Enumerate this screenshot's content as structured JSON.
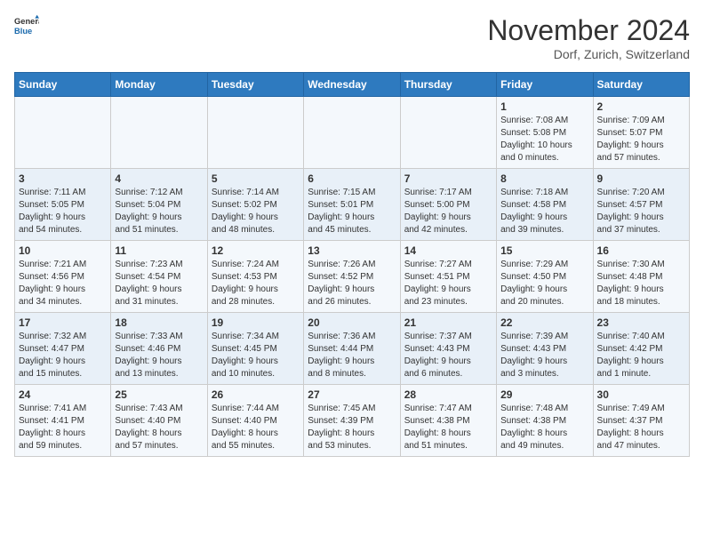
{
  "header": {
    "logo_line1": "General",
    "logo_line2": "Blue",
    "month_title": "November 2024",
    "location": "Dorf, Zurich, Switzerland"
  },
  "weekdays": [
    "Sunday",
    "Monday",
    "Tuesday",
    "Wednesday",
    "Thursday",
    "Friday",
    "Saturday"
  ],
  "weeks": [
    [
      {
        "day": "",
        "info": ""
      },
      {
        "day": "",
        "info": ""
      },
      {
        "day": "",
        "info": ""
      },
      {
        "day": "",
        "info": ""
      },
      {
        "day": "",
        "info": ""
      },
      {
        "day": "1",
        "info": "Sunrise: 7:08 AM\nSunset: 5:08 PM\nDaylight: 10 hours\nand 0 minutes."
      },
      {
        "day": "2",
        "info": "Sunrise: 7:09 AM\nSunset: 5:07 PM\nDaylight: 9 hours\nand 57 minutes."
      }
    ],
    [
      {
        "day": "3",
        "info": "Sunrise: 7:11 AM\nSunset: 5:05 PM\nDaylight: 9 hours\nand 54 minutes."
      },
      {
        "day": "4",
        "info": "Sunrise: 7:12 AM\nSunset: 5:04 PM\nDaylight: 9 hours\nand 51 minutes."
      },
      {
        "day": "5",
        "info": "Sunrise: 7:14 AM\nSunset: 5:02 PM\nDaylight: 9 hours\nand 48 minutes."
      },
      {
        "day": "6",
        "info": "Sunrise: 7:15 AM\nSunset: 5:01 PM\nDaylight: 9 hours\nand 45 minutes."
      },
      {
        "day": "7",
        "info": "Sunrise: 7:17 AM\nSunset: 5:00 PM\nDaylight: 9 hours\nand 42 minutes."
      },
      {
        "day": "8",
        "info": "Sunrise: 7:18 AM\nSunset: 4:58 PM\nDaylight: 9 hours\nand 39 minutes."
      },
      {
        "day": "9",
        "info": "Sunrise: 7:20 AM\nSunset: 4:57 PM\nDaylight: 9 hours\nand 37 minutes."
      }
    ],
    [
      {
        "day": "10",
        "info": "Sunrise: 7:21 AM\nSunset: 4:56 PM\nDaylight: 9 hours\nand 34 minutes."
      },
      {
        "day": "11",
        "info": "Sunrise: 7:23 AM\nSunset: 4:54 PM\nDaylight: 9 hours\nand 31 minutes."
      },
      {
        "day": "12",
        "info": "Sunrise: 7:24 AM\nSunset: 4:53 PM\nDaylight: 9 hours\nand 28 minutes."
      },
      {
        "day": "13",
        "info": "Sunrise: 7:26 AM\nSunset: 4:52 PM\nDaylight: 9 hours\nand 26 minutes."
      },
      {
        "day": "14",
        "info": "Sunrise: 7:27 AM\nSunset: 4:51 PM\nDaylight: 9 hours\nand 23 minutes."
      },
      {
        "day": "15",
        "info": "Sunrise: 7:29 AM\nSunset: 4:50 PM\nDaylight: 9 hours\nand 20 minutes."
      },
      {
        "day": "16",
        "info": "Sunrise: 7:30 AM\nSunset: 4:48 PM\nDaylight: 9 hours\nand 18 minutes."
      }
    ],
    [
      {
        "day": "17",
        "info": "Sunrise: 7:32 AM\nSunset: 4:47 PM\nDaylight: 9 hours\nand 15 minutes."
      },
      {
        "day": "18",
        "info": "Sunrise: 7:33 AM\nSunset: 4:46 PM\nDaylight: 9 hours\nand 13 minutes."
      },
      {
        "day": "19",
        "info": "Sunrise: 7:34 AM\nSunset: 4:45 PM\nDaylight: 9 hours\nand 10 minutes."
      },
      {
        "day": "20",
        "info": "Sunrise: 7:36 AM\nSunset: 4:44 PM\nDaylight: 9 hours\nand 8 minutes."
      },
      {
        "day": "21",
        "info": "Sunrise: 7:37 AM\nSunset: 4:43 PM\nDaylight: 9 hours\nand 6 minutes."
      },
      {
        "day": "22",
        "info": "Sunrise: 7:39 AM\nSunset: 4:43 PM\nDaylight: 9 hours\nand 3 minutes."
      },
      {
        "day": "23",
        "info": "Sunrise: 7:40 AM\nSunset: 4:42 PM\nDaylight: 9 hours\nand 1 minute."
      }
    ],
    [
      {
        "day": "24",
        "info": "Sunrise: 7:41 AM\nSunset: 4:41 PM\nDaylight: 8 hours\nand 59 minutes."
      },
      {
        "day": "25",
        "info": "Sunrise: 7:43 AM\nSunset: 4:40 PM\nDaylight: 8 hours\nand 57 minutes."
      },
      {
        "day": "26",
        "info": "Sunrise: 7:44 AM\nSunset: 4:40 PM\nDaylight: 8 hours\nand 55 minutes."
      },
      {
        "day": "27",
        "info": "Sunrise: 7:45 AM\nSunset: 4:39 PM\nDaylight: 8 hours\nand 53 minutes."
      },
      {
        "day": "28",
        "info": "Sunrise: 7:47 AM\nSunset: 4:38 PM\nDaylight: 8 hours\nand 51 minutes."
      },
      {
        "day": "29",
        "info": "Sunrise: 7:48 AM\nSunset: 4:38 PM\nDaylight: 8 hours\nand 49 minutes."
      },
      {
        "day": "30",
        "info": "Sunrise: 7:49 AM\nSunset: 4:37 PM\nDaylight: 8 hours\nand 47 minutes."
      }
    ]
  ]
}
